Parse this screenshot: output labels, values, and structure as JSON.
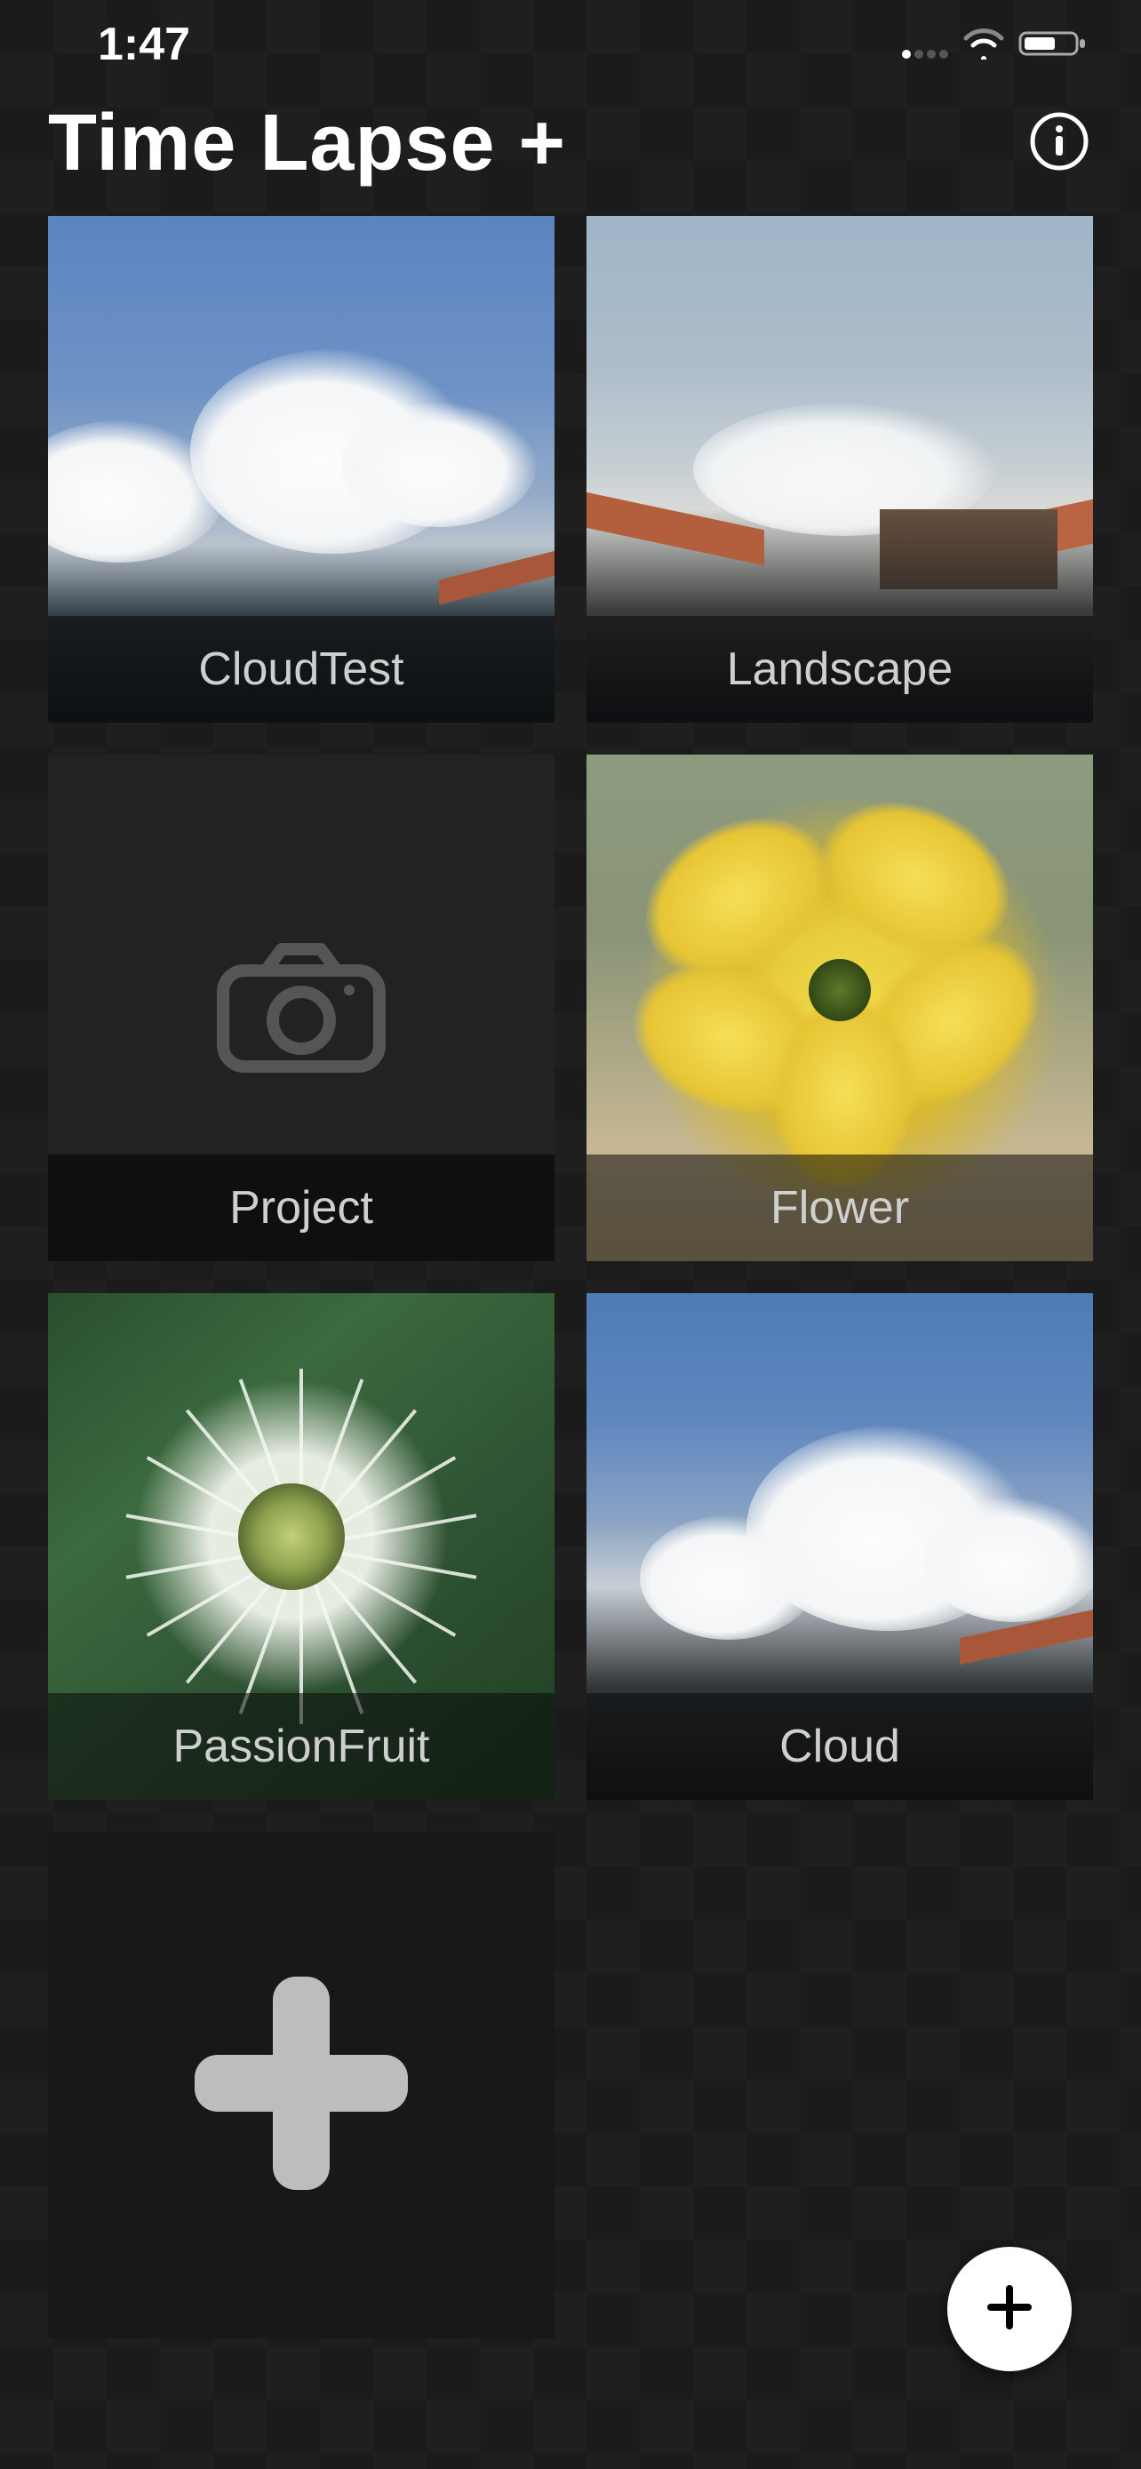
{
  "status": {
    "time": "1:47"
  },
  "header": {
    "title": "Time Lapse +"
  },
  "projects": [
    {
      "label": "CloudTest"
    },
    {
      "label": "Landscape"
    },
    {
      "label": "Project"
    },
    {
      "label": "Flower"
    },
    {
      "label": "PassionFruit"
    },
    {
      "label": "Cloud"
    }
  ]
}
